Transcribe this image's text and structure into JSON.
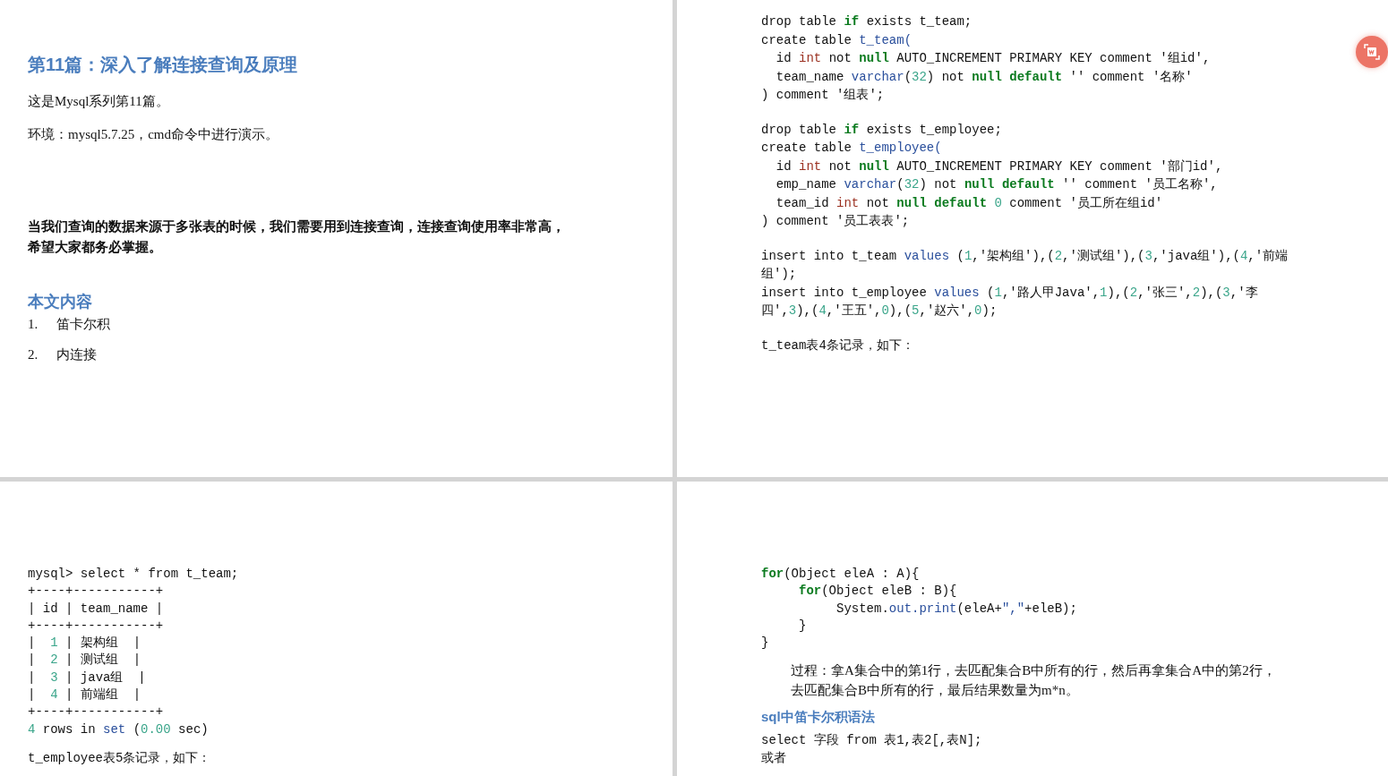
{
  "page_rows": [
    {
      "pages": [
        {
          "blocks": [
            {
              "kind": "title",
              "text": "第11篇：深入了解连接查询及原理"
            },
            {
              "kind": "paragraph",
              "text": "这是Mysql系列第11篇。"
            },
            {
              "kind": "paragraph",
              "text": "环境：mysql5.7.25，cmd命令中进行演示。"
            },
            {
              "kind": "bold_paragraph",
              "text": "当我们查询的数据来源于多张表的时候，我们需要用到连接查询，连接查询使用率非常高，希望大家都务必掌握。"
            },
            {
              "kind": "heading",
              "text": "本文内容"
            },
            {
              "kind": "list_item",
              "number": "1.",
              "text": "笛卡尔积"
            },
            {
              "kind": "list_item",
              "number": "2.",
              "text": "内连接"
            }
          ]
        },
        {
          "blocks": [
            {
              "kind": "code",
              "lines": [
                [
                  {
                    "kind": "plain",
                    "text": "drop table "
                  },
                  {
                    "kind": "keyword",
                    "text": "if"
                  },
                  {
                    "kind": "plain",
                    "text": " exists t_team;"
                  }
                ],
                [
                  {
                    "kind": "plain",
                    "text": "create table "
                  },
                  {
                    "kind": "ident",
                    "text": "t_team("
                  }
                ],
                [
                  {
                    "kind": "plain",
                    "text": "  id "
                  },
                  {
                    "kind": "type",
                    "text": "int"
                  },
                  {
                    "kind": "plain",
                    "text": " not "
                  },
                  {
                    "kind": "keyword",
                    "text": "null"
                  },
                  {
                    "kind": "plain",
                    "text": " AUTO_INCREMENT PRIMARY KEY comment '组id',"
                  }
                ],
                [
                  {
                    "kind": "plain",
                    "text": "  team_name "
                  },
                  {
                    "kind": "ident",
                    "text": "varchar"
                  },
                  {
                    "kind": "plain",
                    "text": "("
                  },
                  {
                    "kind": "number",
                    "text": "32"
                  },
                  {
                    "kind": "plain",
                    "text": ") not "
                  },
                  {
                    "kind": "keyword",
                    "text": "null default"
                  },
                  {
                    "kind": "plain",
                    "text": " '' comment '名称'"
                  }
                ],
                [
                  {
                    "kind": "plain",
                    "text": ") comment '组表';"
                  }
                ]
              ]
            },
            {
              "kind": "code",
              "lines": [
                [
                  {
                    "kind": "plain",
                    "text": "drop table "
                  },
                  {
                    "kind": "keyword",
                    "text": "if"
                  },
                  {
                    "kind": "plain",
                    "text": " exists t_employee;"
                  }
                ],
                [
                  {
                    "kind": "plain",
                    "text": "create table "
                  },
                  {
                    "kind": "ident",
                    "text": "t_employee("
                  }
                ],
                [
                  {
                    "kind": "plain",
                    "text": "  id "
                  },
                  {
                    "kind": "type",
                    "text": "int"
                  },
                  {
                    "kind": "plain",
                    "text": " not "
                  },
                  {
                    "kind": "keyword",
                    "text": "null"
                  },
                  {
                    "kind": "plain",
                    "text": " AUTO_INCREMENT PRIMARY KEY comment '部门id',"
                  }
                ],
                [
                  {
                    "kind": "plain",
                    "text": "  emp_name "
                  },
                  {
                    "kind": "ident",
                    "text": "varchar"
                  },
                  {
                    "kind": "plain",
                    "text": "("
                  },
                  {
                    "kind": "number",
                    "text": "32"
                  },
                  {
                    "kind": "plain",
                    "text": ") not "
                  },
                  {
                    "kind": "keyword",
                    "text": "null default"
                  },
                  {
                    "kind": "plain",
                    "text": " '' comment '员工名称',"
                  }
                ],
                [
                  {
                    "kind": "plain",
                    "text": "  team_id "
                  },
                  {
                    "kind": "type",
                    "text": "int"
                  },
                  {
                    "kind": "plain",
                    "text": " not "
                  },
                  {
                    "kind": "keyword",
                    "text": "null default "
                  },
                  {
                    "kind": "number",
                    "text": "0"
                  },
                  {
                    "kind": "plain",
                    "text": " comment '员工所在组id'"
                  }
                ],
                [
                  {
                    "kind": "plain",
                    "text": ") comment '员工表表';"
                  }
                ]
              ]
            },
            {
              "kind": "code",
              "lines": [
                [
                  {
                    "kind": "plain",
                    "text": "insert into t_team "
                  },
                  {
                    "kind": "ident",
                    "text": "values"
                  },
                  {
                    "kind": "plain",
                    "text": " ("
                  },
                  {
                    "kind": "number",
                    "text": "1"
                  },
                  {
                    "kind": "plain",
                    "text": ",'架构组'),("
                  },
                  {
                    "kind": "number",
                    "text": "2"
                  },
                  {
                    "kind": "plain",
                    "text": ",'测试组'),("
                  },
                  {
                    "kind": "number",
                    "text": "3"
                  },
                  {
                    "kind": "plain",
                    "text": ",'java组'),("
                  },
                  {
                    "kind": "number",
                    "text": "4"
                  },
                  {
                    "kind": "plain",
                    "text": ",'前端"
                  }
                ],
                [
                  {
                    "kind": "plain",
                    "text": "组');"
                  }
                ],
                [
                  {
                    "kind": "plain",
                    "text": "insert into t_employee "
                  },
                  {
                    "kind": "ident",
                    "text": "values"
                  },
                  {
                    "kind": "plain",
                    "text": " ("
                  },
                  {
                    "kind": "number",
                    "text": "1"
                  },
                  {
                    "kind": "plain",
                    "text": ",'路人甲Java',"
                  },
                  {
                    "kind": "number",
                    "text": "1"
                  },
                  {
                    "kind": "plain",
                    "text": "),("
                  },
                  {
                    "kind": "number",
                    "text": "2"
                  },
                  {
                    "kind": "plain",
                    "text": ",'张三',"
                  },
                  {
                    "kind": "number",
                    "text": "2"
                  },
                  {
                    "kind": "plain",
                    "text": "),("
                  },
                  {
                    "kind": "number",
                    "text": "3"
                  },
                  {
                    "kind": "plain",
                    "text": ",'李"
                  }
                ],
                [
                  {
                    "kind": "plain",
                    "text": "四',"
                  },
                  {
                    "kind": "number",
                    "text": "3"
                  },
                  {
                    "kind": "plain",
                    "text": "),("
                  },
                  {
                    "kind": "number",
                    "text": "4"
                  },
                  {
                    "kind": "plain",
                    "text": ",'王五',"
                  },
                  {
                    "kind": "number",
                    "text": "0"
                  },
                  {
                    "kind": "plain",
                    "text": "),("
                  },
                  {
                    "kind": "number",
                    "text": "5"
                  },
                  {
                    "kind": "plain",
                    "text": ",'赵六',"
                  },
                  {
                    "kind": "number",
                    "text": "0"
                  },
                  {
                    "kind": "plain",
                    "text": ");"
                  }
                ]
              ]
            },
            {
              "kind": "mono_paragraph",
              "text": "t_team表4条记录，如下："
            }
          ]
        }
      ]
    },
    {
      "pages": [
        {
          "blocks": [
            {
              "kind": "code",
              "lines": [
                [
                  {
                    "kind": "plain",
                    "text": "mysql> select * from t_team;"
                  }
                ],
                [
                  {
                    "kind": "plain",
                    "text": "+----+-----------+"
                  }
                ],
                [
                  {
                    "kind": "plain",
                    "text": "| id | team_name |"
                  }
                ],
                [
                  {
                    "kind": "plain",
                    "text": "+----+-----------+"
                  }
                ],
                [
                  {
                    "kind": "plain",
                    "text": "|  "
                  },
                  {
                    "kind": "number",
                    "text": "1"
                  },
                  {
                    "kind": "plain",
                    "text": " | 架构组  |"
                  }
                ],
                [
                  {
                    "kind": "plain",
                    "text": "|  "
                  },
                  {
                    "kind": "number",
                    "text": "2"
                  },
                  {
                    "kind": "plain",
                    "text": " | 测试组  |"
                  }
                ],
                [
                  {
                    "kind": "plain",
                    "text": "|  "
                  },
                  {
                    "kind": "number",
                    "text": "3"
                  },
                  {
                    "kind": "plain",
                    "text": " | java组  |"
                  }
                ],
                [
                  {
                    "kind": "plain",
                    "text": "|  "
                  },
                  {
                    "kind": "number",
                    "text": "4"
                  },
                  {
                    "kind": "plain",
                    "text": " | 前端组  |"
                  }
                ],
                [
                  {
                    "kind": "plain",
                    "text": "+----+-----------+"
                  }
                ],
                [
                  {
                    "kind": "number",
                    "text": "4"
                  },
                  {
                    "kind": "plain",
                    "text": " rows in "
                  },
                  {
                    "kind": "ident",
                    "text": "set"
                  },
                  {
                    "kind": "plain",
                    "text": " ("
                  },
                  {
                    "kind": "number",
                    "text": "0.00"
                  },
                  {
                    "kind": "plain",
                    "text": " sec)"
                  }
                ]
              ]
            },
            {
              "kind": "mono_paragraph",
              "text": "t_employee表5条记录，如下："
            }
          ]
        },
        {
          "blocks": [
            {
              "kind": "code",
              "lines": [
                [
                  {
                    "kind": "keyword",
                    "text": "for"
                  },
                  {
                    "kind": "plain",
                    "text": "(Object eleA : A){"
                  }
                ],
                [
                  {
                    "kind": "keyword",
                    "text": "     for"
                  },
                  {
                    "kind": "plain",
                    "text": "(Object eleB : B){"
                  }
                ],
                [
                  {
                    "kind": "plain",
                    "text": "          System."
                  },
                  {
                    "kind": "ident",
                    "text": "out.print"
                  },
                  {
                    "kind": "plain",
                    "text": "(eleA+"
                  },
                  {
                    "kind": "ident",
                    "text": "\",\""
                  },
                  {
                    "kind": "plain",
                    "text": "+eleB);"
                  }
                ],
                [
                  {
                    "kind": "plain",
                    "text": "     }"
                  }
                ],
                [
                  {
                    "kind": "plain",
                    "text": "}"
                  }
                ]
              ]
            },
            {
              "kind": "indented_paragraph",
              "text": "过程：拿A集合中的第1行，去匹配集合B中所有的行，然后再拿集合A中的第2行，去匹配集合B中所有的行，最后结果数量为m*n。"
            },
            {
              "kind": "subheading",
              "text": "sql中笛卡尔积语法"
            },
            {
              "kind": "code",
              "lines": [
                [
                  {
                    "kind": "plain",
                    "text": "select 字段 from 表1,表2[,表N];"
                  }
                ],
                [
                  {
                    "kind": "plain",
                    "text": "或者"
                  }
                ]
              ]
            }
          ]
        }
      ]
    }
  ],
  "floating_button": {
    "kind": "word_convert"
  }
}
